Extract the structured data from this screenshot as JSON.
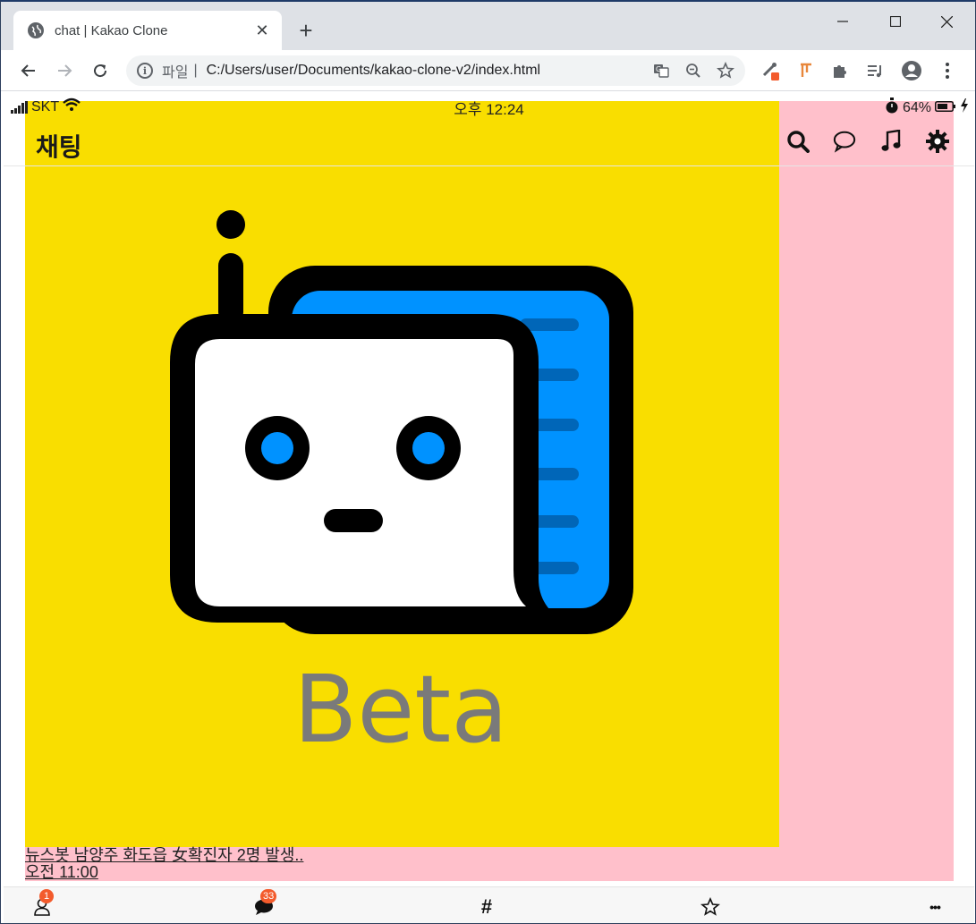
{
  "browser": {
    "tab_title": "chat | Kakao Clone",
    "tab_close": "✕",
    "new_tab": "+",
    "window_controls": {
      "minimize": "—",
      "maximize": "☐",
      "close": "✕"
    },
    "omnibox": {
      "info_icon": "i",
      "scheme_label": "파일",
      "separator": "|",
      "url": "C:/Users/user/Documents/kakao-clone-v2/index.html"
    },
    "icons": [
      "back-icon",
      "forward-icon",
      "reload-icon",
      "translate-icon",
      "zoom-out-icon",
      "star-icon",
      "eyedropper-icon",
      "bookmark-ext-icon",
      "puzzle-icon",
      "media-icon",
      "profile-icon",
      "menu-icon"
    ]
  },
  "status_bar": {
    "carrier": "SKT",
    "time": "오후 12:24",
    "battery": "64%"
  },
  "header": {
    "title": "채팅",
    "icons": [
      "search-icon",
      "chat-bubble-icon",
      "music-note-icon",
      "gear-icon"
    ]
  },
  "image": {
    "alt_text": "Beta",
    "colors": {
      "background": "#f9de00",
      "panel": "#ffc0cb",
      "screen": "#0092ff",
      "outline": "#000000"
    }
  },
  "chat_preview": {
    "message": "뉴스봇 남양주 화도읍 女확진자 2명 발생..",
    "time": "오전 11:00"
  },
  "tab_bar": {
    "items": [
      {
        "name": "friends-icon",
        "badge": "1"
      },
      {
        "name": "chats-icon",
        "badge": "33"
      },
      {
        "name": "hashtag-icon",
        "label": "#"
      },
      {
        "name": "star-icon"
      },
      {
        "name": "more-icon",
        "label": "•••"
      }
    ]
  }
}
